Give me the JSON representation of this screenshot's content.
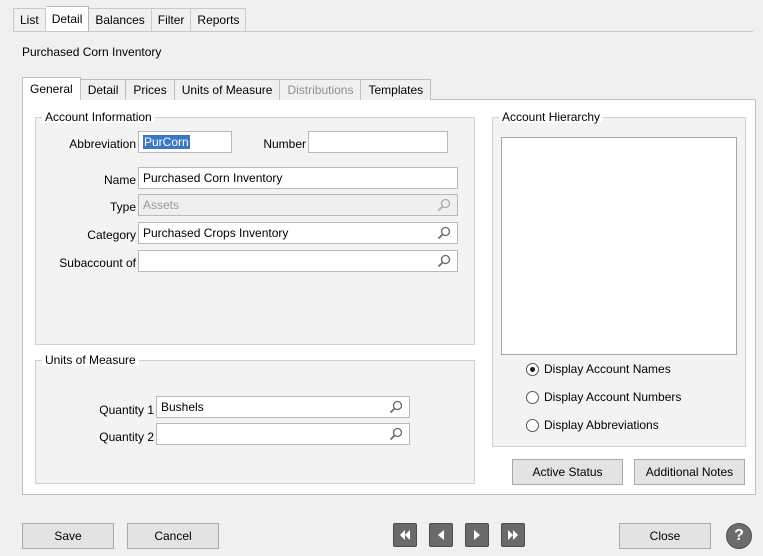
{
  "top_tabs": {
    "list": "List",
    "detail": "Detail",
    "balances": "Balances",
    "filter": "Filter",
    "reports": "Reports"
  },
  "record_title": "Purchased Corn Inventory",
  "sub_tabs": {
    "general": "General",
    "detail": "Detail",
    "prices": "Prices",
    "units": "Units of Measure",
    "distributions": "Distributions",
    "templates": "Templates"
  },
  "account_info": {
    "title": "Account Information",
    "abbreviation_label": "Abbreviation",
    "abbreviation_value": "PurCorn",
    "number_label": "Number",
    "number_value": "",
    "name_label": "Name",
    "name_value": "Purchased Corn Inventory",
    "type_label": "Type",
    "type_value": "Assets",
    "category_label": "Category",
    "category_value": "Purchased Crops Inventory",
    "subaccount_label": "Subaccount of",
    "subaccount_value": ""
  },
  "units_group": {
    "title": "Units of Measure",
    "q1_label": "Quantity 1",
    "q1_value": "Bushels",
    "q2_label": "Quantity 2",
    "q2_value": ""
  },
  "hierarchy": {
    "title": "Account Hierarchy",
    "options": {
      "names": "Display Account Names",
      "numbers": "Display Account Numbers",
      "abbreviations": "Display Abbreviations"
    },
    "selected": "names"
  },
  "buttons": {
    "active_status": "Active Status",
    "additional_notes": "Additional Notes",
    "save": "Save",
    "cancel": "Cancel",
    "close": "Close",
    "help": "?"
  },
  "icons": {
    "lookup": "magnifier-icon",
    "first": "first-record-icon",
    "prev": "previous-record-icon",
    "next": "next-record-icon",
    "last": "last-record-icon",
    "help": "help-icon"
  }
}
